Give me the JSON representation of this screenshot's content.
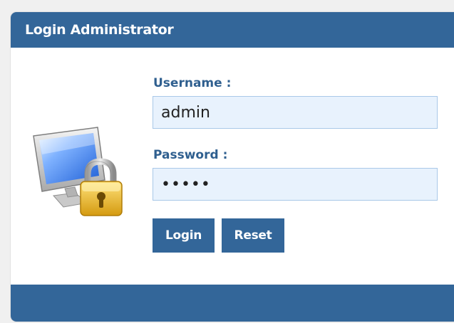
{
  "header": {
    "title": "Login Administrator"
  },
  "form": {
    "username_label": "Username :",
    "username_value": "admin",
    "password_label": "Password :",
    "password_value": "•••••",
    "login_label": "Login",
    "reset_label": "Reset"
  },
  "icons": {
    "illustration": "computer-lock-icon"
  },
  "colors": {
    "accent": "#336699",
    "label": "#2f5f8f",
    "input_background": "#e8f2fd",
    "input_border": "#a9c8e8"
  }
}
